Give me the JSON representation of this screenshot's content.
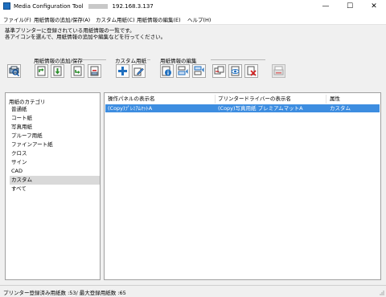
{
  "window": {
    "title": "Media Configuration Tool",
    "printer_address": "192.168.3.137",
    "minimize_glyph": "—",
    "maximize_glyph": "☐",
    "close_glyph": "✕"
  },
  "menu": [
    "ファイル(F)",
    "用紙情報の追加/保存(A)",
    "カスタム用紙(C)",
    "用紙情報の編集(E)",
    "ヘルプ(H)"
  ],
  "description": {
    "line1": "基準プリンターに登録されている用紙情報の一覧です。",
    "line2": "各アイコンを選んで、用紙情報の追加や編集などを行ってください。"
  },
  "toolbar": {
    "groups": [
      "用紙情報の追加/保存",
      "カスタム用紙",
      "用紙情報の編集"
    ],
    "buttons": [
      {
        "icon": "printer-search-icon",
        "enabled": true
      },
      {
        "icon": "add-from-printer-icon",
        "enabled": true
      },
      {
        "icon": "download-icon",
        "enabled": true
      },
      {
        "icon": "save-to-printer-icon",
        "enabled": true
      },
      {
        "icon": "delete-from-printer-icon",
        "enabled": true
      },
      {
        "icon": "add-custom-icon",
        "enabled": true
      },
      {
        "icon": "edit-custom-icon",
        "enabled": true
      },
      {
        "icon": "info-icon",
        "enabled": true
      },
      {
        "icon": "move-up-icon",
        "enabled": true
      },
      {
        "icon": "move-down-icon",
        "enabled": true
      },
      {
        "icon": "copy-icon",
        "enabled": true
      },
      {
        "icon": "view-icon",
        "enabled": true
      },
      {
        "icon": "delete-icon",
        "enabled": true
      },
      {
        "icon": "printer-disabled-icon",
        "enabled": false
      }
    ]
  },
  "categories": {
    "header": "用紙のカテゴリ",
    "items": [
      "普通紙",
      "コート紙",
      "写真用紙",
      "プルーフ用紙",
      "ファインアート紙",
      "クロス",
      "サイン",
      "CAD",
      "カスタム",
      "すべて"
    ],
    "selected": "カスタム"
  },
  "media_list": {
    "columns": [
      "操作パネルの表示名",
      "プリンタードライバーの表示名",
      "属性"
    ],
    "rows": [
      {
        "panel_name": "(Copy)ﾌﾟﾚﾐｱﾑﾏｯﾄA",
        "driver_name": "(Copy)写真用紙 プレミアムマットA",
        "attribute": "カスタム",
        "selected": true
      }
    ]
  },
  "status": {
    "text": "プリンター登録済み用紙数 :53/ 最大登録用紙数 :65"
  },
  "colors": {
    "selection": "#3d8de0",
    "accent_blue": "#1f6fbf"
  }
}
